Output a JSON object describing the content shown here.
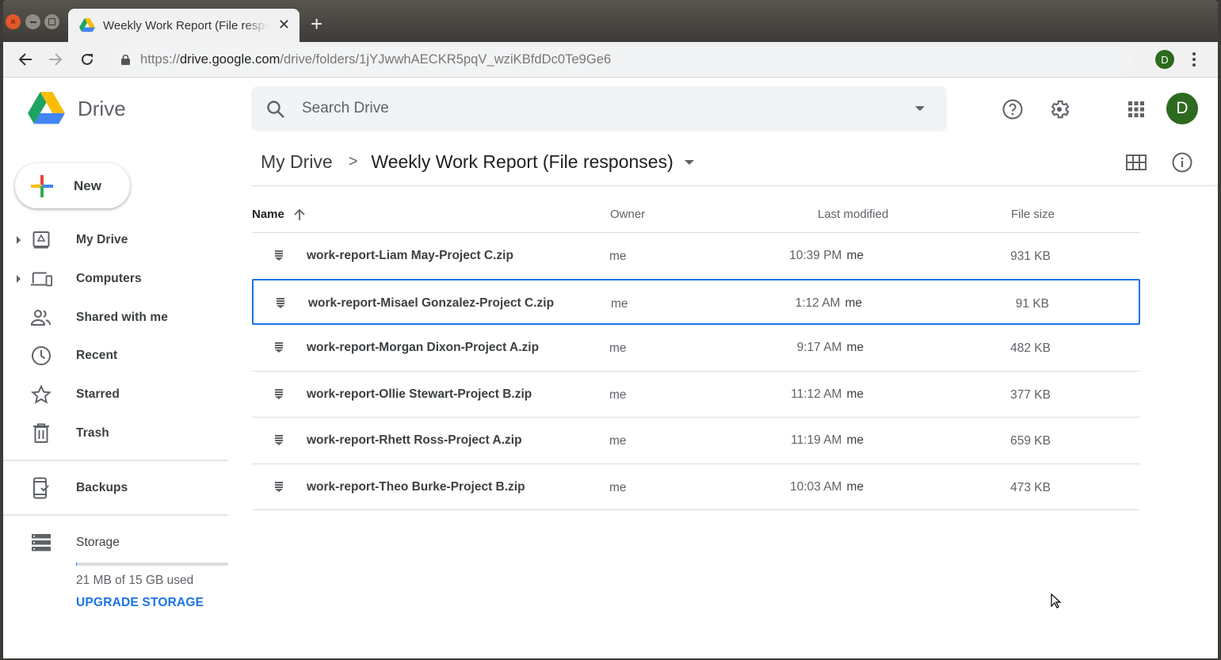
{
  "browser": {
    "tab_title": "Weekly Work Report (File responses) - Google Drive",
    "url_scheme": "https://",
    "url_host": "drive.google.com",
    "url_path": "/drive/folders/1jYJwwhAECKR5pqV_wziKBfdDc0Te9Ge6",
    "profile_initial": "D"
  },
  "app": {
    "name": "Drive",
    "search_placeholder": "Search Drive",
    "user_initial": "D"
  },
  "sidebar": {
    "new_label": "New",
    "items": [
      {
        "label": "My Drive",
        "icon": "my-drive-icon",
        "expandable": true
      },
      {
        "label": "Computers",
        "icon": "computers-icon",
        "expandable": true
      },
      {
        "label": "Shared with me",
        "icon": "shared-icon",
        "expandable": false
      },
      {
        "label": "Recent",
        "icon": "clock-icon",
        "expandable": false
      },
      {
        "label": "Starred",
        "icon": "star-icon",
        "expandable": false
      },
      {
        "label": "Trash",
        "icon": "trash-icon",
        "expandable": false
      }
    ],
    "backups_label": "Backups",
    "storage_label": "Storage",
    "storage_used_fraction": 0.0014,
    "storage_text": "21 MB of 15 GB used",
    "upgrade_label": "UPGRADE STORAGE"
  },
  "breadcrumb": {
    "root": "My Drive",
    "separator": ">",
    "current": "Weekly Work Report (File responses)"
  },
  "table": {
    "columns": {
      "name": "Name",
      "owner": "Owner",
      "modified": "Last modified",
      "size": "File size"
    },
    "sort": "name-ascending",
    "rows": [
      {
        "name": "work-report-Liam May-Project C.zip",
        "owner": "me",
        "modified": "10:39 PM",
        "modified_by": "me",
        "size": "931 KB",
        "selected": false
      },
      {
        "name": "work-report-Misael Gonzalez-Project C.zip",
        "owner": "me",
        "modified": "1:12 AM",
        "modified_by": "me",
        "size": "91 KB",
        "selected": true
      },
      {
        "name": "work-report-Morgan Dixon-Project A.zip",
        "owner": "me",
        "modified": "9:17 AM",
        "modified_by": "me",
        "size": "482 KB",
        "selected": false
      },
      {
        "name": "work-report-Ollie Stewart-Project B.zip",
        "owner": "me",
        "modified": "11:12 AM",
        "modified_by": "me",
        "size": "377 KB",
        "selected": false
      },
      {
        "name": "work-report-Rhett Ross-Project A.zip",
        "owner": "me",
        "modified": "11:19 AM",
        "modified_by": "me",
        "size": "659 KB",
        "selected": false
      },
      {
        "name": "work-report-Theo Burke-Project B.zip",
        "owner": "me",
        "modified": "10:03 AM",
        "modified_by": "me",
        "size": "473 KB",
        "selected": false
      }
    ]
  },
  "colors": {
    "accent": "#1a73e8",
    "avatar": "#2d6a1f",
    "titlebar": "#3c3b37"
  }
}
